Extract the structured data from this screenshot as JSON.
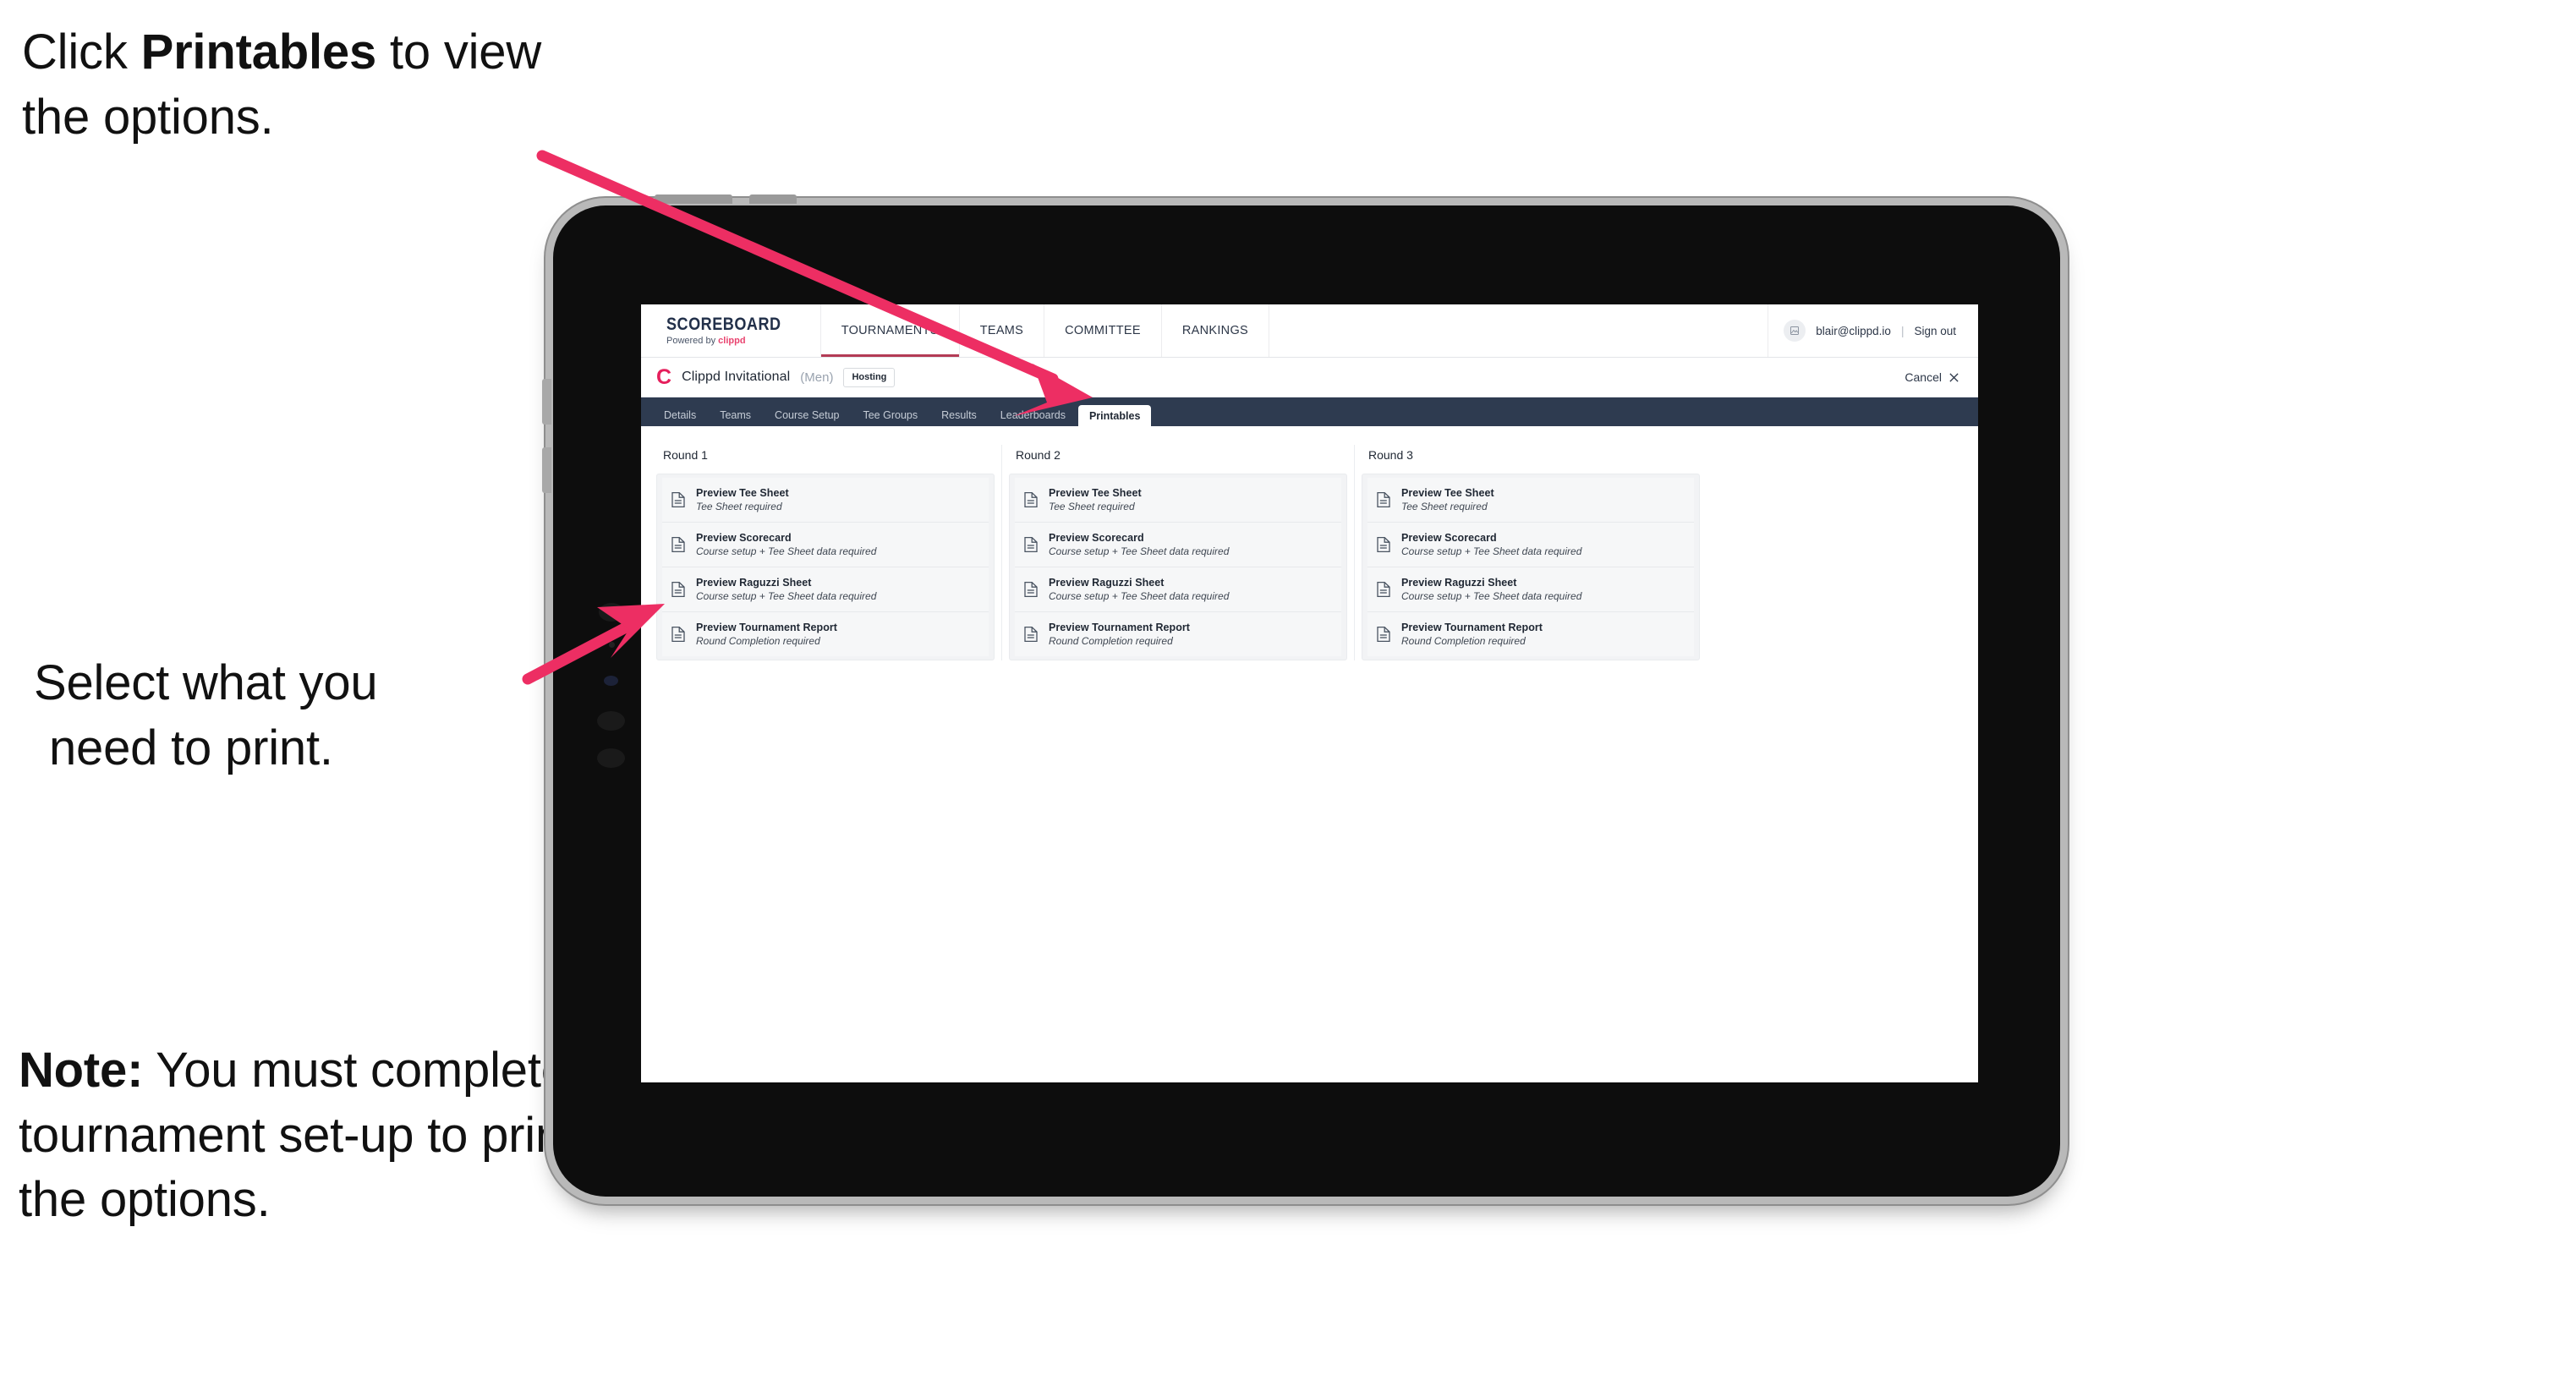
{
  "callouts": {
    "one": {
      "pre": "Click ",
      "strong": "Printables",
      "post": " to view the options."
    },
    "two": {
      "line1": "Select what you",
      "line2": "need to print."
    },
    "three": {
      "strong": "Note:",
      "rest": " You must complete the tournament set-up to print all the options."
    }
  },
  "app": {
    "brand": {
      "title": "SCOREBOARD",
      "sub_prefix": "Powered by ",
      "sub_accent": "clippd"
    },
    "top_nav": [
      {
        "label": "TOURNAMENTS",
        "active": true
      },
      {
        "label": "TEAMS",
        "active": false
      },
      {
        "label": "COMMITTEE",
        "active": false
      },
      {
        "label": "RANKINGS",
        "active": false
      }
    ],
    "account": {
      "avatar_icon": "user-avatar-icon",
      "email": "blair@clippd.io",
      "separator": "|",
      "sign_out": "Sign out"
    },
    "tournament": {
      "logo_letter": "C",
      "name": "Clippd Invitational",
      "gender": "(Men)",
      "badge": "Hosting",
      "cancel_label": "Cancel",
      "cancel_icon": "close-icon"
    },
    "tabs": [
      {
        "label": "Details",
        "active": false
      },
      {
        "label": "Teams",
        "active": false
      },
      {
        "label": "Course Setup",
        "active": false
      },
      {
        "label": "Tee Groups",
        "active": false
      },
      {
        "label": "Results",
        "active": false
      },
      {
        "label": "Leaderboards",
        "active": false
      },
      {
        "label": "Printables",
        "active": true
      }
    ],
    "rounds": [
      {
        "title": "Round 1",
        "items": [
          {
            "title": "Preview Tee Sheet",
            "sub": "Tee Sheet required"
          },
          {
            "title": "Preview Scorecard",
            "sub": "Course setup + Tee Sheet data required"
          },
          {
            "title": "Preview Raguzzi Sheet",
            "sub": "Course setup + Tee Sheet data required"
          },
          {
            "title": "Preview Tournament Report",
            "sub": "Round Completion required"
          }
        ]
      },
      {
        "title": "Round 2",
        "items": [
          {
            "title": "Preview Tee Sheet",
            "sub": "Tee Sheet required"
          },
          {
            "title": "Preview Scorecard",
            "sub": "Course setup + Tee Sheet data required"
          },
          {
            "title": "Preview Raguzzi Sheet",
            "sub": "Course setup + Tee Sheet data required"
          },
          {
            "title": "Preview Tournament Report",
            "sub": "Round Completion required"
          }
        ]
      },
      {
        "title": "Round 3",
        "items": [
          {
            "title": "Preview Tee Sheet",
            "sub": "Tee Sheet required"
          },
          {
            "title": "Preview Scorecard",
            "sub": "Course setup + Tee Sheet data required"
          },
          {
            "title": "Preview Raguzzi Sheet",
            "sub": "Course setup + Tee Sheet data required"
          },
          {
            "title": "Preview Tournament Report",
            "sub": "Round Completion required"
          }
        ]
      }
    ]
  },
  "colors": {
    "arrow": "#ED2E63",
    "tabbar": "#2E3B50",
    "brand_accent": "#E9436F",
    "tournament_logo": "#E51F5C"
  }
}
